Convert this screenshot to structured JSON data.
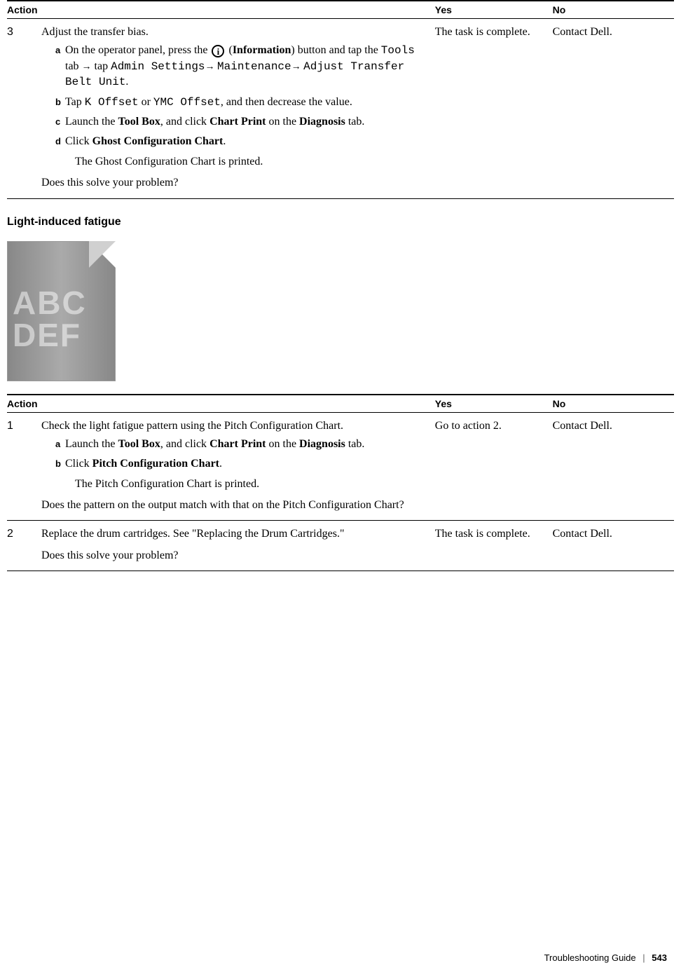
{
  "table1": {
    "headers": {
      "action": "Action",
      "yes": "Yes",
      "no": "No"
    },
    "row": {
      "num": "3",
      "main": "Adjust the transfer bias.",
      "a_pre": "On the operator panel, press the ",
      "a_info": "Information",
      "a_mid": ") button and tap the ",
      "a_mono1": "Tools",
      "a_mid2": " tab ",
      "a_mid3": " tap ",
      "a_mono2": "Admin Settings",
      "a_mono3": "Maintenance",
      "a_mono4": "Adjust Transfer Belt Unit",
      "b_pre": "Tap ",
      "b_mono1": "K Offset",
      "b_mid": " or ",
      "b_mono2": "YMC Offset",
      "b_post": ", and then decrease the value.",
      "c_pre": "Launch the ",
      "c_b1": "Tool Box",
      "c_mid": ", and click ",
      "c_b2": "Chart Print",
      "c_mid2": " on the ",
      "c_b3": "Diagnosis",
      "c_post": " tab.",
      "d_pre": "Click ",
      "d_b1": "Ghost Configuration Chart",
      "d_result": "The Ghost Configuration Chart is printed.",
      "closing": "Does this solve your problem?",
      "yes": "The task is complete.",
      "no": "Contact Dell."
    }
  },
  "heading": "Light-induced fatigue",
  "illustration": {
    "line1": "ABC",
    "line2": "DEF"
  },
  "table2": {
    "headers": {
      "action": "Action",
      "yes": "Yes",
      "no": "No"
    },
    "row1": {
      "num": "1",
      "main": "Check the light fatigue pattern using the Pitch Configuration Chart.",
      "a_pre": "Launch the ",
      "a_b1": "Tool Box",
      "a_mid": ", and click ",
      "a_b2": "Chart Print",
      "a_mid2": " on the ",
      "a_b3": "Diagnosis",
      "a_post": " tab.",
      "b_pre": "Click ",
      "b_b1": "Pitch Configuration Chart",
      "b_result": "The Pitch Configuration Chart is printed.",
      "closing": "Does the pattern on the output match with that on the Pitch Configuration Chart?",
      "yes": "Go to action 2.",
      "no": "Contact Dell."
    },
    "row2": {
      "num": "2",
      "main": "Replace the drum cartridges. See \"Replacing the Drum Cartridges.\"",
      "closing": "Does this solve your problem?",
      "yes": "The task is complete.",
      "no": "Contact Dell."
    }
  },
  "footer": {
    "title": "Troubleshooting Guide",
    "page": "543"
  }
}
